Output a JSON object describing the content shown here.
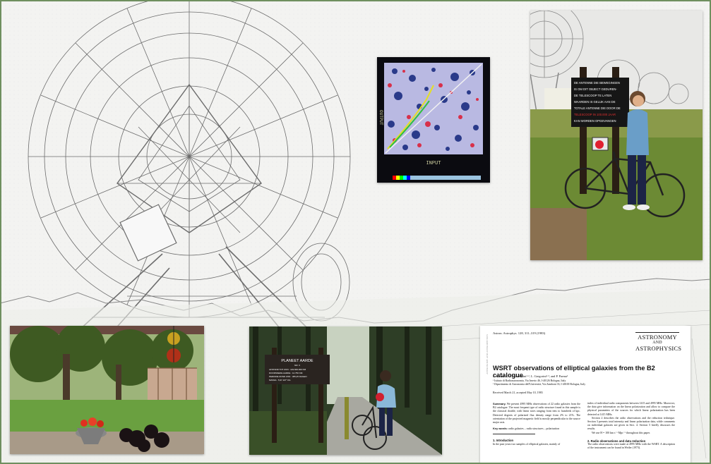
{
  "sign_1": {
    "lines": [
      "DE ANTENNE DIE BEWEGINGEN",
      "IS OM DIT OBJECT GEDUREN-",
      "DE TELESCOOP TE LATEN",
      "WAARDEN IS GELIJK AAN DE",
      "TOTALE ANTENNE DIE DOOR DE",
      "TELESCOOP IN 100.000 JAAR",
      "KAN WORDEN OPGEVANGEN"
    ]
  },
  "sign_2": {
    "title": "PLANEET AARDE",
    "lines": [
      "NR. 3",
      "AFSTAND TOT ZON : 149.600.000 KM",
      "DOORSNEDE AARDE : 12.756 KM",
      "PERIODE ROND ZON : 365,25 DAGEN",
      "MASSA : 5,97·10²⁴ KG"
    ]
  },
  "monitor": {
    "axis_x": "INPUT",
    "axis_y": "OUTPUT"
  },
  "paper": {
    "citation": "Astron. Astrophys. 128, 311–319 (1983)",
    "journal": [
      "ASTRONOMY",
      "AND",
      "ASTROPHYSICS"
    ],
    "side_stamp": "ASTRONOMY AND ASTROPHYSICS",
    "title": "WSRT observations of elliptical galaxies from the B2 catalogue",
    "authors": "L. Parma¹·², G. Giovannini¹·², L. Gregorini¹·², and P. Parma¹",
    "affiliations": [
      "¹ Istituto di Radioastronomia, Via Irnerio 46, I-40126 Bologna, Italy",
      "² Dipartimento di Astronomia dell'Università, Via Zamboni 33, I-40100 Bologna, Italy"
    ],
    "received": "Received March 21, accepted May 10, 1983",
    "summary_label": "Summary.",
    "summary": "We present 4995 MHz observations of 22 radio galaxies from the B2 catalogue. The most frequent type of radio structure found in this sample is the classical double, with linear sizes ranging from tens to hundreds of kpc. Detected degrees of polarized flux density range from 2% to 21%. The orientation of the projected magnetic field is mostly perpendicular to the source major axis.",
    "keywords_label": "Key words:",
    "keywords": "radio galaxies – radio structures – polarization",
    "section_1": "1. Introduction",
    "section_1_text": "In the past years two samples of elliptical galaxies, mainly of",
    "right_text": "index of individual radio components between 1415 and 4995 MHz. Moreover, the data give information on the linear polarization and allow to compare the physical parameters of the sources for which linear polarization has been detected at 1415 MHz.",
    "right_text_2": "Section 2 describes the radio observations and the reduction technique. Section 3 presents total intensity and linear polarization data, while comments on individual galaxies are given in Sect. 4. Section 5 briefly discusses the results.",
    "right_text_3": "We use H = 100 km s⁻¹ Mpc⁻¹ throughout this paper.",
    "section_2": "2. Radio observations and data reduction",
    "section_2_text": "The radio observations were made at 4995 MHz with the WSRT. A description of the instrument can be found in Weiler (1973)."
  },
  "colors": {
    "frame": "#6f8f5f",
    "sign_text": "#ffffff",
    "sign_highlight": "#e23030",
    "monitor_bg": "#b8b8e0"
  }
}
